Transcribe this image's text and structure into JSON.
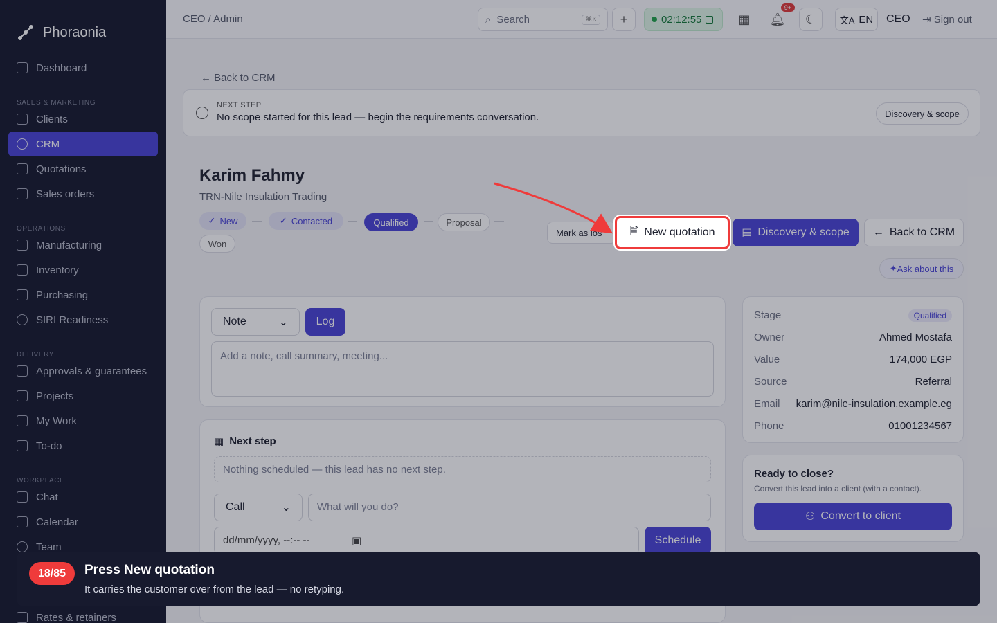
{
  "brand": {
    "name": "Phoraonia"
  },
  "sidebar": {
    "dashboard": "Dashboard",
    "sections": [
      {
        "title": "SALES & MARKETING",
        "items": [
          "Clients",
          "CRM",
          "Quotations",
          "Sales orders"
        ]
      },
      {
        "title": "OPERATIONS",
        "items": [
          "Manufacturing",
          "Inventory",
          "Purchasing",
          "SIRI Readiness"
        ]
      },
      {
        "title": "DELIVERY",
        "items": [
          "Approvals & guarantees",
          "Projects",
          "My Work",
          "To-do"
        ]
      },
      {
        "title": "WORKPLACE",
        "items": [
          "Chat",
          "Calendar",
          "Team"
        ]
      }
    ],
    "partial_item": "Rates & retainers"
  },
  "topbar": {
    "breadcrumb": "CEO / Admin",
    "search_placeholder": "Search",
    "search_kbd": "⌘K",
    "timer": "02:12:55",
    "notif_badge": "9+",
    "lang": "EN",
    "role": "CEO",
    "signout": "Sign out"
  },
  "page": {
    "back": "Back to CRM",
    "next_step_label": "NEXT STEP",
    "next_step_text": "No scope started for this lead — begin the requirements conversation.",
    "next_step_button": "Discovery & scope",
    "lead_name": "Karim Fahmy",
    "lead_company": "TRN-Nile Insulation Trading",
    "stages": [
      "New",
      "Contacted",
      "Qualified",
      "Proposal",
      "Won"
    ],
    "mark_lost": "Mark as los",
    "new_quotation": "New quotation",
    "discovery_button": "Discovery & scope",
    "back_button": "Back to CRM",
    "ask": "Ask about this"
  },
  "activity": {
    "type": "Note",
    "log": "Log",
    "placeholder": "Add a note, call summary, meeting..."
  },
  "next_step_card": {
    "title": "Next step",
    "empty": "Nothing scheduled — this lead has no next step.",
    "type": "Call",
    "placeholder": "What will you do?",
    "date_placeholder": "dd/mm/yyyy, --:-- --",
    "schedule": "Schedule"
  },
  "details": {
    "rows": [
      {
        "k": "Stage",
        "v": "Qualified"
      },
      {
        "k": "Owner",
        "v": "Ahmed Mostafa"
      },
      {
        "k": "Value",
        "v": "174,000 EGP"
      },
      {
        "k": "Source",
        "v": "Referral"
      },
      {
        "k": "Email",
        "v": "karim@nile-insulation.example.eg"
      },
      {
        "k": "Phone",
        "v": "01001234567"
      }
    ]
  },
  "close": {
    "title": "Ready to close?",
    "subtitle": "Convert this lead into a client (with a contact).",
    "button": "Convert to client"
  },
  "tour": {
    "step": "18/85",
    "title": "Press New quotation",
    "subtitle": "It carries the customer over from the lead — no retyping."
  },
  "colors": {
    "accent": "#4a44d6",
    "highlight": "#ef3b3b",
    "sidebar": "#171a2e"
  }
}
